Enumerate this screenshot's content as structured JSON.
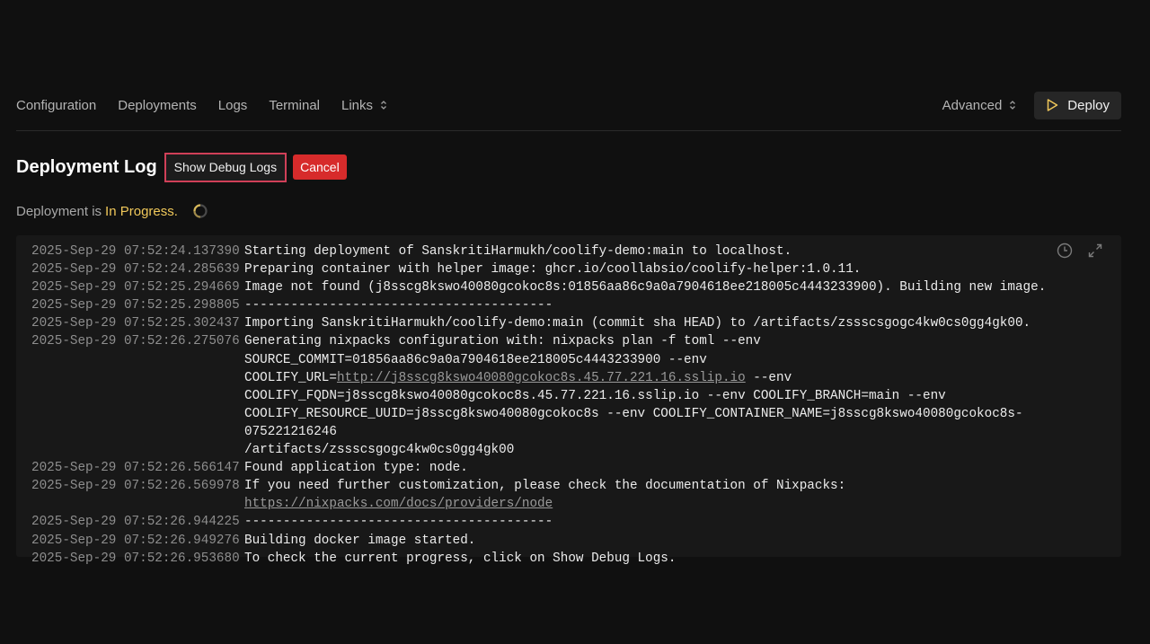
{
  "nav": {
    "configuration": "Configuration",
    "deployments": "Deployments",
    "logs": "Logs",
    "terminal": "Terminal",
    "links": "Links",
    "advanced": "Advanced",
    "deploy": "Deploy"
  },
  "header": {
    "title": "Deployment Log",
    "debug_button": "Show Debug Logs",
    "cancel_button": "Cancel"
  },
  "status": {
    "prefix": "Deployment is",
    "state": "In Progress."
  },
  "colors": {
    "accent_yellow": "#f0c85a",
    "cancel_red": "#d72b2b",
    "highlight_border": "#d04058"
  },
  "logs": {
    "l1": {
      "ts": "2025-Sep-29 07:52:24.137390",
      "msg": "Starting deployment of SanskritiHarmukh/coolify-demo:main to localhost."
    },
    "l2": {
      "ts": "2025-Sep-29 07:52:24.285639",
      "msg": "Preparing container with helper image: ghcr.io/coollabsio/coolify-helper:1.0.11."
    },
    "l3": {
      "ts": "2025-Sep-29 07:52:25.294669",
      "msg": "Image not found (j8sscg8kswo40080gcokoc8s:01856aa86c9a0a7904618ee218005c4443233900). Building new image."
    },
    "l4": {
      "ts": "2025-Sep-29 07:52:25.298805",
      "msg": "----------------------------------------"
    },
    "l5": {
      "ts": "2025-Sep-29 07:52:25.302437",
      "msg": "Importing SanskritiHarmukh/coolify-demo:main (commit sha HEAD) to /artifacts/zssscsgogc4kw0cs0gg4gk00."
    },
    "l6": {
      "ts": "2025-Sep-29 07:52:26.275076",
      "msg_a": "Generating nixpacks configuration with: nixpacks plan -f toml --env\nSOURCE_COMMIT=01856aa86c9a0a7904618ee218005c4443233900 --env\nCOOLIFY_URL=",
      "link": "http://j8sscg8kswo40080gcokoc8s.45.77.221.16.sslip.io",
      "msg_b": " --env\nCOOLIFY_FQDN=j8sscg8kswo40080gcokoc8s.45.77.221.16.sslip.io --env COOLIFY_BRANCH=main --env\nCOOLIFY_RESOURCE_UUID=j8sscg8kswo40080gcokoc8s --env COOLIFY_CONTAINER_NAME=j8sscg8kswo40080gcokoc8s-075221216246\n/artifacts/zssscsgogc4kw0cs0gg4gk00"
    },
    "l7": {
      "ts": "2025-Sep-29 07:52:26.566147",
      "msg": "Found application type: node."
    },
    "l8": {
      "ts": "2025-Sep-29 07:52:26.569978",
      "msg": "If you need further customization, please check the documentation of Nixpacks:\n",
      "link": "https://nixpacks.com/docs/providers/node"
    },
    "l9": {
      "ts": "2025-Sep-29 07:52:26.944225",
      "msg": "----------------------------------------"
    },
    "l10": {
      "ts": "2025-Sep-29 07:52:26.949276",
      "msg": "Building docker image started."
    },
    "l11": {
      "ts": "2025-Sep-29 07:52:26.953680",
      "msg": "To check the current progress, click on Show Debug Logs."
    }
  }
}
